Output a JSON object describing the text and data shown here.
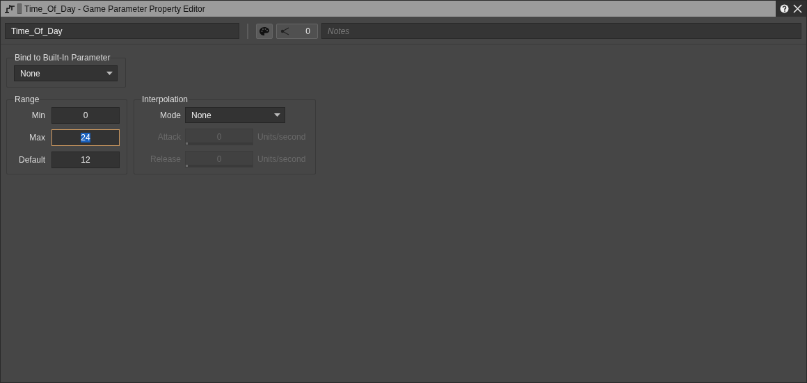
{
  "window": {
    "title": "Time_Of_Day - Game Parameter Property Editor"
  },
  "toolbar": {
    "name_value": "Time_Of_Day",
    "share_count": "0",
    "notes_placeholder": "Notes"
  },
  "bind_group": {
    "title": "Bind to Built-In Parameter",
    "value": "None"
  },
  "range_group": {
    "title": "Range",
    "fields": [
      {
        "label": "Min",
        "value": "0",
        "focused": false
      },
      {
        "label": "Max",
        "value": "24",
        "focused": true
      },
      {
        "label": "Default",
        "value": "12",
        "focused": false
      }
    ]
  },
  "interpolation_group": {
    "title": "Interpolation",
    "mode_label": "Mode",
    "mode_value": "None",
    "rows": [
      {
        "label": "Attack",
        "value": "0",
        "unit": "Units/second",
        "disabled": true,
        "level": 0
      },
      {
        "label": "Release",
        "value": "0",
        "unit": "Units/second",
        "disabled": true,
        "level": 0
      }
    ]
  }
}
